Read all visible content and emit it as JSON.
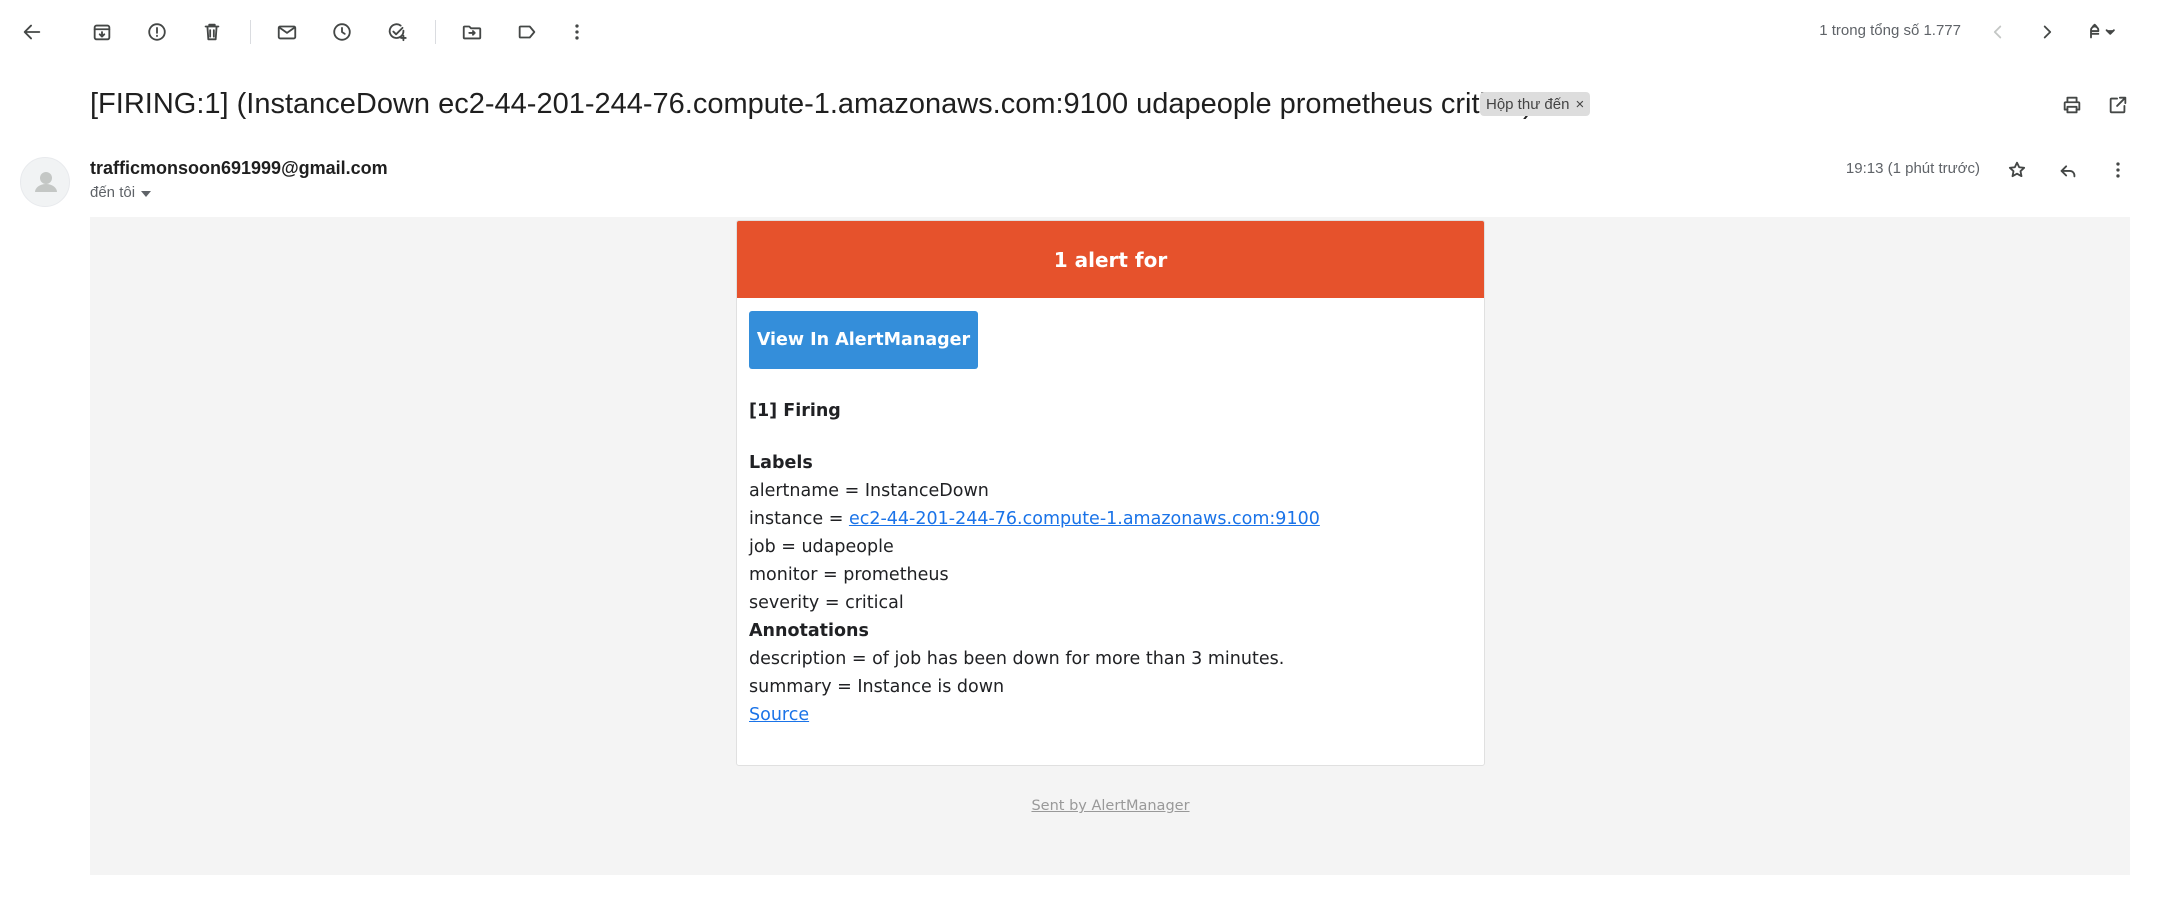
{
  "toolbar": {
    "icons": [
      "back-arrow-icon",
      "archive-icon",
      "report-spam-icon",
      "delete-icon",
      "mark-unread-icon",
      "snooze-icon",
      "add-task-icon",
      "move-to-icon",
      "label-icon",
      "more-vert-icon"
    ],
    "pager_text": "1 trong tổng số 1.777"
  },
  "subject": {
    "title": "[FIRING:1] (InstanceDown ec2-44-201-244-76.compute-1.amazonaws.com:9100 udapeople prometheus critical)",
    "chip_label": "Hộp thư đến",
    "chip_close": "×"
  },
  "sender": {
    "email": "trafficmonsoon691999@gmail.com",
    "to_label": "đến tôi",
    "time": "19:13 (1 phút trước)"
  },
  "alert": {
    "header": "1 alert for",
    "button_label": "View In AlertManager",
    "firing_heading": "[1] Firing",
    "labels_heading": "Labels",
    "labels": {
      "alertname": "alertname = InstanceDown",
      "instance_prefix": "instance = ",
      "instance_link": "ec2-44-201-244-76.compute-1.amazonaws.com:9100",
      "job": "job = udapeople",
      "monitor": "monitor = prometheus",
      "severity": "severity = critical"
    },
    "annotations_heading": "Annotations",
    "annotations": {
      "description": "description = of job has been down for more than 3 minutes.",
      "summary": "summary = Instance is down"
    },
    "source_link": "Source",
    "footer": "Sent by AlertManager"
  },
  "colors": {
    "alert_header_bg": "#e6522c",
    "button_bg": "#348eda",
    "link": "#1a73e8",
    "message_bg": "#f4f4f4"
  }
}
